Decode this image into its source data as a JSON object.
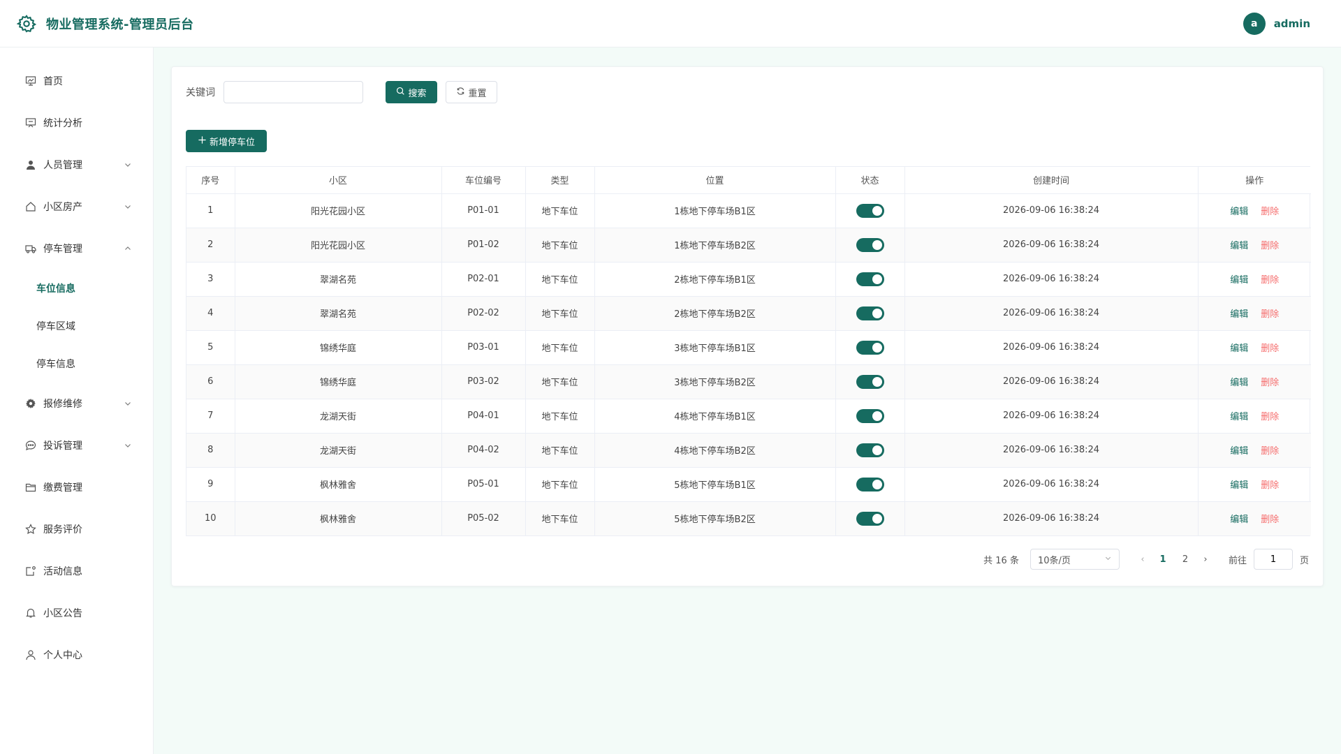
{
  "header": {
    "title": "物业管理系统-管理员后台",
    "avatar_letter": "a",
    "username": "admin"
  },
  "sidebar": {
    "items": [
      {
        "label": "首页",
        "icon": "chart-board-icon"
      },
      {
        "label": "统计分析",
        "icon": "presentation-icon"
      },
      {
        "label": "人员管理",
        "icon": "user-icon",
        "expandable": true
      },
      {
        "label": "小区房产",
        "icon": "house-icon",
        "expandable": true
      },
      {
        "label": "停车管理",
        "icon": "truck-icon",
        "expandable": true,
        "expanded": true
      },
      {
        "label": "报修维修",
        "icon": "gear-icon",
        "expandable": true
      },
      {
        "label": "投诉管理",
        "icon": "chat-icon",
        "expandable": true
      },
      {
        "label": "缴费管理",
        "icon": "folder-icon"
      },
      {
        "label": "服务评价",
        "icon": "star-icon"
      },
      {
        "label": "活动信息",
        "icon": "activity-icon"
      },
      {
        "label": "小区公告",
        "icon": "bell-icon"
      },
      {
        "label": "个人中心",
        "icon": "person-icon"
      }
    ],
    "parking_sub": [
      {
        "label": "车位信息",
        "active": true
      },
      {
        "label": "停车区域",
        "active": false
      },
      {
        "label": "停车信息",
        "active": false
      }
    ]
  },
  "search": {
    "keyword_label": "关键词",
    "keyword_value": "",
    "search_label": "搜索",
    "reset_label": "重置"
  },
  "add_button": {
    "label": "新增停车位"
  },
  "table": {
    "columns": [
      "序号",
      "小区",
      "车位编号",
      "类型",
      "位置",
      "状态",
      "创建时间",
      "操作"
    ],
    "rows": [
      {
        "no": "1",
        "community": "阳光花园小区",
        "code": "P01-01",
        "type": "地下车位",
        "location": "1栋地下停车场B1区",
        "status": true,
        "created": "2026-09-06 16:38:24"
      },
      {
        "no": "2",
        "community": "阳光花园小区",
        "code": "P01-02",
        "type": "地下车位",
        "location": "1栋地下停车场B2区",
        "status": true,
        "created": "2026-09-06 16:38:24"
      },
      {
        "no": "3",
        "community": "翠湖名苑",
        "code": "P02-01",
        "type": "地下车位",
        "location": "2栋地下停车场B1区",
        "status": true,
        "created": "2026-09-06 16:38:24"
      },
      {
        "no": "4",
        "community": "翠湖名苑",
        "code": "P02-02",
        "type": "地下车位",
        "location": "2栋地下停车场B2区",
        "status": true,
        "created": "2026-09-06 16:38:24"
      },
      {
        "no": "5",
        "community": "锦绣华庭",
        "code": "P03-01",
        "type": "地下车位",
        "location": "3栋地下停车场B1区",
        "status": true,
        "created": "2026-09-06 16:38:24"
      },
      {
        "no": "6",
        "community": "锦绣华庭",
        "code": "P03-02",
        "type": "地下车位",
        "location": "3栋地下停车场B2区",
        "status": true,
        "created": "2026-09-06 16:38:24"
      },
      {
        "no": "7",
        "community": "龙湖天街",
        "code": "P04-01",
        "type": "地下车位",
        "location": "4栋地下停车场B1区",
        "status": true,
        "created": "2026-09-06 16:38:24"
      },
      {
        "no": "8",
        "community": "龙湖天街",
        "code": "P04-02",
        "type": "地下车位",
        "location": "4栋地下停车场B2区",
        "status": true,
        "created": "2026-09-06 16:38:24"
      },
      {
        "no": "9",
        "community": "枫林雅舍",
        "code": "P05-01",
        "type": "地下车位",
        "location": "5栋地下停车场B1区",
        "status": true,
        "created": "2026-09-06 16:38:24"
      },
      {
        "no": "10",
        "community": "枫林雅舍",
        "code": "P05-02",
        "type": "地下车位",
        "location": "5栋地下停车场B2区",
        "status": true,
        "created": "2026-09-06 16:38:24"
      }
    ],
    "edit_label": "编辑",
    "delete_label": "删除"
  },
  "pagination": {
    "total_text": "共 16 条",
    "page_size": "10条/页",
    "pages": [
      "1",
      "2"
    ],
    "current_page": "1",
    "goto_label": "前往",
    "goto_value": "1",
    "page_unit": "页"
  },
  "colors": {
    "primary": "#166b60",
    "danger": "#f56c6c",
    "background": "#f3fbf8"
  }
}
